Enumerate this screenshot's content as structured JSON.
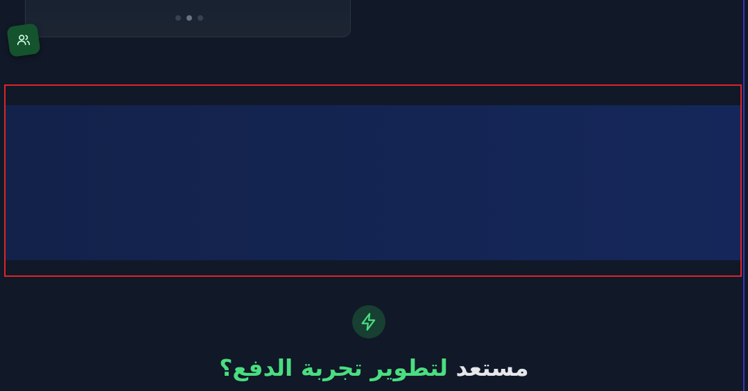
{
  "top_card": {
    "dots": [
      {
        "active": false
      },
      {
        "active": true
      },
      {
        "active": false
      }
    ]
  },
  "floating_badge": {
    "icon": "users-icon"
  },
  "cta": {
    "icon": "lightning-icon",
    "title_prefix": "مستعد ",
    "title_highlight": "لتطوير تجربة الدفع؟"
  },
  "colors": {
    "background": "#111827",
    "accent_green": "#4ade80",
    "band_blue": "#14255a",
    "highlight_red": "#dc2626",
    "edge_line": "#4338ca"
  }
}
